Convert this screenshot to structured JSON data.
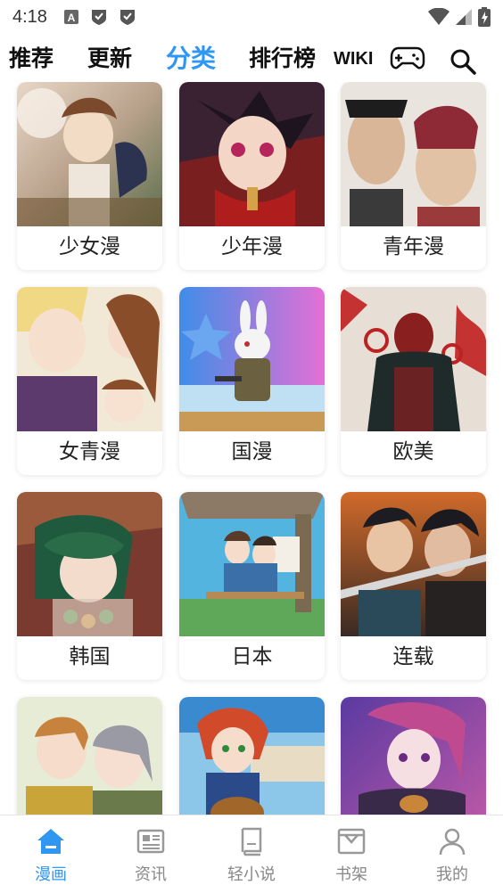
{
  "status_bar": {
    "time": "4:18"
  },
  "top_nav": {
    "tabs": [
      "推荐",
      "更新",
      "分类",
      "排行榜",
      "WIKI"
    ],
    "active_tab": "分类",
    "icons": [
      "gamepad-icon",
      "search-icon"
    ]
  },
  "categories": [
    {
      "label": "少女漫"
    },
    {
      "label": "少年漫"
    },
    {
      "label": "青年漫"
    },
    {
      "label": "女青漫"
    },
    {
      "label": "国漫"
    },
    {
      "label": "欧美"
    },
    {
      "label": "韩国"
    },
    {
      "label": "日本"
    },
    {
      "label": "连载"
    },
    {
      "label": ""
    },
    {
      "label": ""
    },
    {
      "label": ""
    }
  ],
  "bottom_tabs": [
    {
      "label": "漫画",
      "icon": "home-icon",
      "active": true
    },
    {
      "label": "资讯",
      "icon": "news-icon",
      "active": false
    },
    {
      "label": "轻小说",
      "icon": "book-icon",
      "active": false
    },
    {
      "label": "书架",
      "icon": "bookshelf-icon",
      "active": false
    },
    {
      "label": "我的",
      "icon": "user-icon",
      "active": false
    }
  ],
  "colors": {
    "accent": "#2f96f2"
  }
}
